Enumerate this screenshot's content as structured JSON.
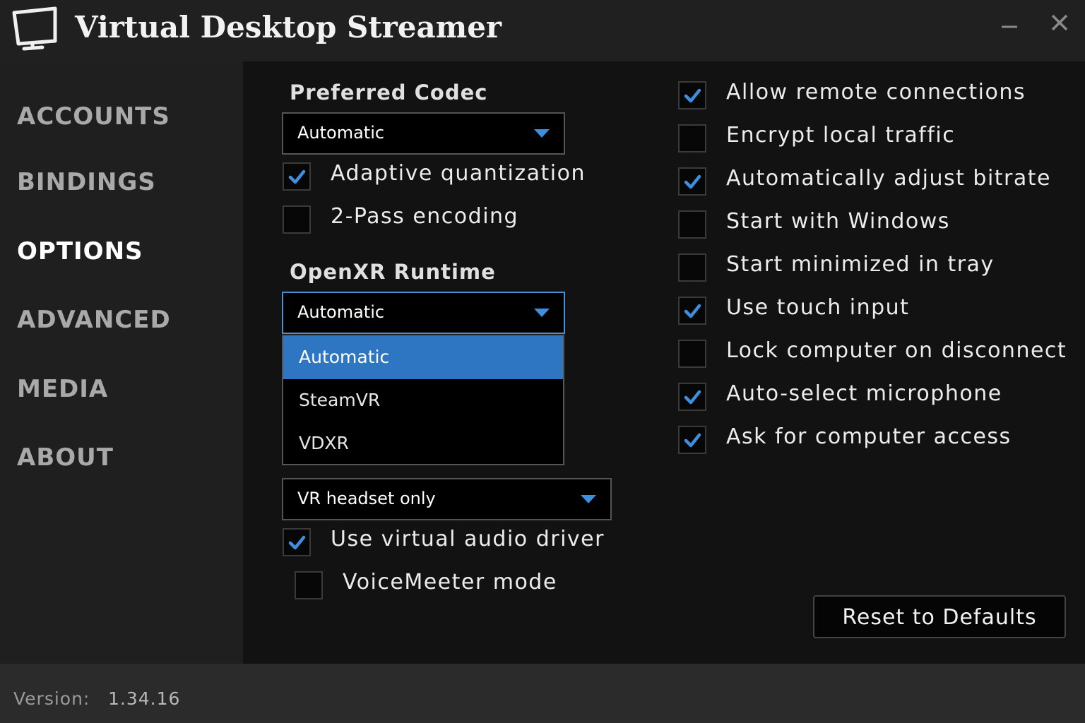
{
  "window": {
    "title": "Virtual Desktop Streamer",
    "minimize_icon": "minimize-icon",
    "close_icon": "close-icon"
  },
  "sidebar": {
    "items": [
      {
        "label": "ACCOUNTS",
        "active": false
      },
      {
        "label": "BINDINGS",
        "active": false
      },
      {
        "label": "OPTIONS",
        "active": true
      },
      {
        "label": "ADVANCED",
        "active": false
      },
      {
        "label": "MEDIA",
        "active": false
      },
      {
        "label": "ABOUT",
        "active": false
      }
    ]
  },
  "options": {
    "preferred_codec": {
      "label": "Preferred Codec",
      "value": "Automatic"
    },
    "adaptive_quantization": {
      "label": "Adaptive quantization",
      "checked": true
    },
    "two_pass_encoding": {
      "label": "2-Pass encoding",
      "checked": false
    },
    "openxr_runtime": {
      "label": "OpenXR Runtime",
      "value": "Automatic",
      "open": true,
      "options": [
        "Automatic",
        "SteamVR",
        "VDXR"
      ],
      "selected_index": 0
    },
    "audio_output": {
      "value": "VR headset only"
    },
    "use_virtual_audio_driver": {
      "label": "Use virtual audio driver",
      "checked": true
    },
    "voicemeeter_mode": {
      "label": "VoiceMeeter mode",
      "checked": false
    },
    "right_checks": [
      {
        "label": "Allow remote connections",
        "checked": true
      },
      {
        "label": "Encrypt local traffic",
        "checked": false
      },
      {
        "label": "Automatically adjust bitrate",
        "checked": true
      },
      {
        "label": "Start with Windows",
        "checked": false
      },
      {
        "label": "Start minimized in tray",
        "checked": false
      },
      {
        "label": "Use touch input",
        "checked": true
      },
      {
        "label": "Lock computer on disconnect",
        "checked": false
      },
      {
        "label": "Auto-select microphone",
        "checked": true
      },
      {
        "label": "Ask for computer access",
        "checked": true
      }
    ],
    "reset_label": "Reset to Defaults"
  },
  "footer": {
    "version_label": "Version:",
    "version_value": "1.34.16"
  },
  "colors": {
    "accent": "#2f76c2",
    "check": "#3d8fe0",
    "background": "#121212"
  }
}
